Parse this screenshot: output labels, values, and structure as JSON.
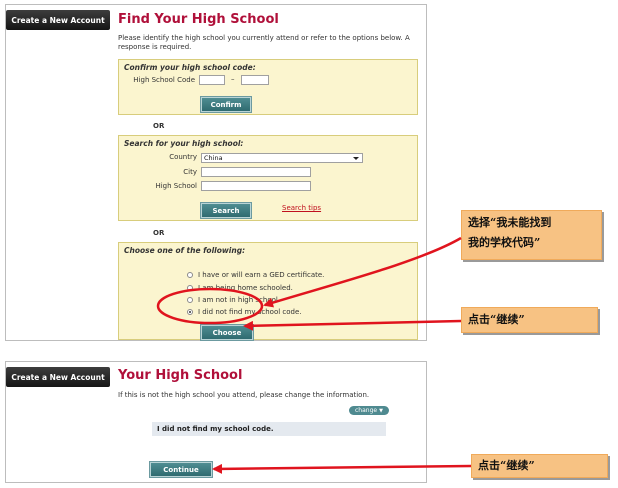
{
  "screen1": {
    "side_tab": "Create a New Account",
    "title": "Find Your High School",
    "intro": "Please identify the high school you currently attend or refer to the options below. A response is required.",
    "confirm_panel": {
      "title": "Confirm your high school code:",
      "code_label": "High School Code",
      "code_value_1": "",
      "code_value_2": "",
      "separator": "–",
      "button": "Confirm"
    },
    "or_1": "OR",
    "search_panel": {
      "title": "Search for your high school:",
      "country_label": "Country",
      "country_value": "China",
      "city_label": "City",
      "city_value": "",
      "highschool_label": "High School",
      "highschool_value": "",
      "button": "Search",
      "tips_link": "Search tips"
    },
    "or_2": "OR",
    "choose_panel": {
      "title": "Choose one of the following:",
      "options": [
        {
          "label": "I have or will earn a GED certificate.",
          "selected": false
        },
        {
          "label": "I am being home schooled.",
          "selected": false
        },
        {
          "label": "I am not in high school.",
          "selected": false
        },
        {
          "label": "I did not find my school code.",
          "selected": true
        }
      ],
      "button": "Choose"
    }
  },
  "screen2": {
    "side_tab": "Create a New Account",
    "title": "Your High School",
    "intro": "If this is not the high school you attend, please change the information.",
    "change_button": "change",
    "school_name": "I did not find my school code.",
    "continue_button": "Continue"
  },
  "callouts": {
    "select_option": "选择“我未能找到我的学校代码”",
    "select_line1": "选择“我未能找到",
    "select_line2": "我的学校代码”",
    "click_continue_1": "点击“继续”",
    "click_continue_2": "点击“继续”"
  },
  "colors": {
    "title_red": "#b0103a",
    "panel_yellow": "#fbf5cf",
    "button_teal": "#2f6b70",
    "callout_orange": "#f7c283",
    "arrow_red": "#e0141e"
  }
}
